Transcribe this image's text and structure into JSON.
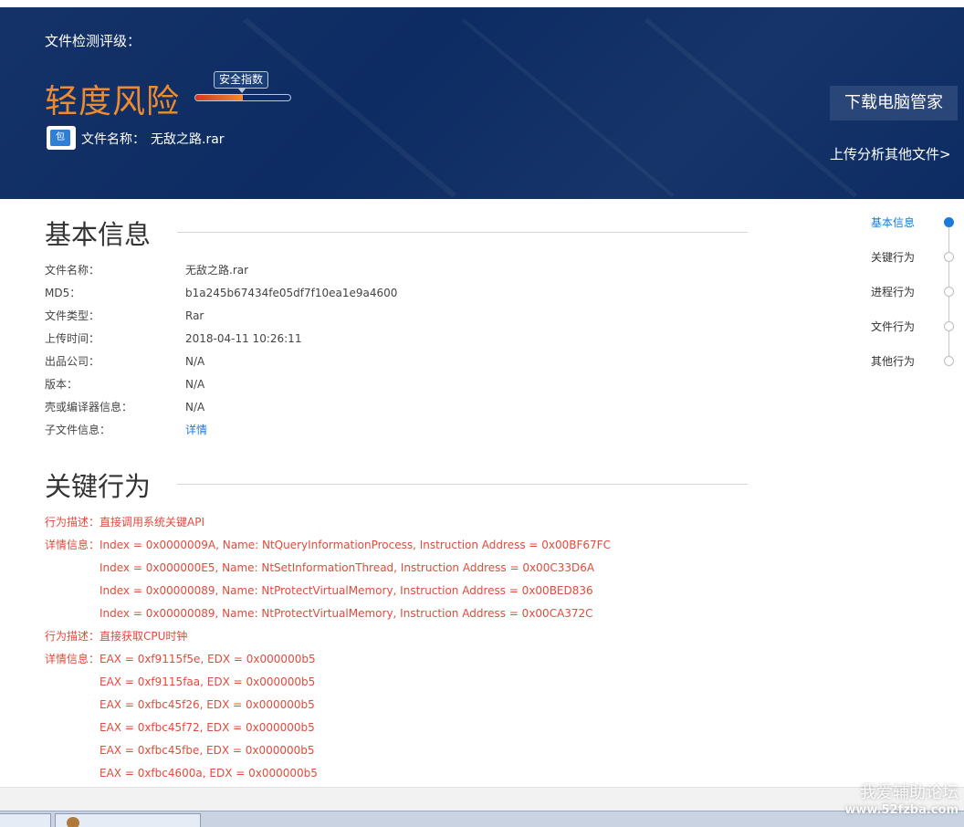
{
  "header": {
    "label": "文件检测评级：",
    "risk_level": "轻度风险",
    "safety_tag": "安全指数",
    "safety_level": 0.5,
    "file_icon_glyph": "包",
    "file_name_label": "文件名称：",
    "file_name": "无敌之路.rar",
    "download_button": "下载电脑管家",
    "upload_link": "上传分析其他文件>",
    "colors": {
      "banner": "#0d2c63",
      "risk": "#f08a2e"
    }
  },
  "basic_info": {
    "title": "基本信息",
    "rows": [
      {
        "key": "文件名称：",
        "value": "无敌之路.rar"
      },
      {
        "key": "MD5：",
        "value": "b1a245b67434fe05df7f10ea1e9a4600"
      },
      {
        "key": "文件类型：",
        "value": "Rar"
      },
      {
        "key": "上传时间：",
        "value": "2018-04-11 10:26:11"
      },
      {
        "key": "出品公司：",
        "value": "N/A"
      },
      {
        "key": "版本：",
        "value": "N/A"
      },
      {
        "key": "壳或编译器信息：",
        "value": "N/A"
      },
      {
        "key": "子文件信息：",
        "value": "详情"
      }
    ]
  },
  "key_behavior": {
    "title": "关键行为",
    "rows": [
      {
        "key": "行为描述：",
        "value": "直接调用系统关键API"
      },
      {
        "key": "详情信息：",
        "value": "Index = 0x0000009A, Name: NtQueryInformationProcess, Instruction Address = 0x00BF67FC"
      },
      {
        "key": "",
        "value": "Index = 0x000000E5, Name: NtSetInformationThread, Instruction Address = 0x00C33D6A"
      },
      {
        "key": "",
        "value": "Index = 0x00000089, Name: NtProtectVirtualMemory, Instruction Address = 0x00BED836"
      },
      {
        "key": "",
        "value": "Index = 0x00000089, Name: NtProtectVirtualMemory, Instruction Address = 0x00CA372C"
      },
      {
        "key": "行为描述：",
        "value": "直接获取CPU时钟"
      },
      {
        "key": "详情信息：",
        "value": "EAX = 0xf9115f5e, EDX = 0x000000b5"
      },
      {
        "key": "",
        "value": "EAX = 0xf9115faa, EDX = 0x000000b5"
      },
      {
        "key": "",
        "value": "EAX = 0xfbc45f26, EDX = 0x000000b5"
      },
      {
        "key": "",
        "value": "EAX = 0xfbc45f72, EDX = 0x000000b5"
      },
      {
        "key": "",
        "value": "EAX = 0xfbc45fbe, EDX = 0x000000b5"
      },
      {
        "key": "",
        "value": "EAX = 0xfbc4600a, EDX = 0x000000b5"
      }
    ]
  },
  "side_nav": {
    "items": [
      {
        "label": "基本信息",
        "active": true
      },
      {
        "label": "关键行为",
        "active": false
      },
      {
        "label": "进程行为",
        "active": false
      },
      {
        "label": "文件行为",
        "active": false
      },
      {
        "label": "其他行为",
        "active": false
      }
    ],
    "active_color": "#1a7bd6"
  },
  "taskbar": {
    "items": [
      {
        "label": ""
      },
      {
        "label": ""
      }
    ]
  },
  "watermark": {
    "line1": "我爱辅助论坛",
    "line2": "www.52fzba.com"
  }
}
